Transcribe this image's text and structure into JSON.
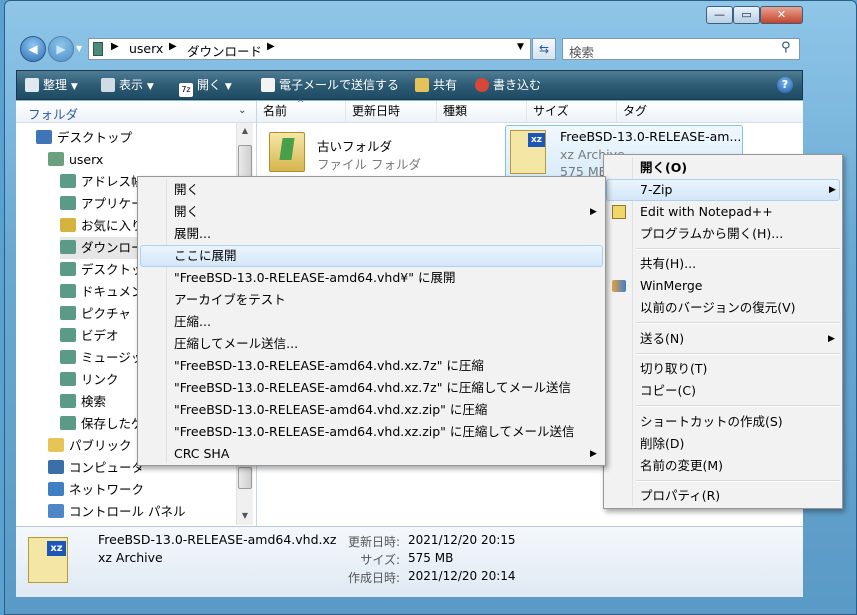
{
  "window": {
    "caption_buttons": [
      "minimize",
      "maximize",
      "close"
    ]
  },
  "nav": {
    "back_icon": "back-arrow-icon",
    "forward_icon": "forward-arrow-icon",
    "address": {
      "crumb_1": "userx",
      "crumb_2": "ダウンロード"
    },
    "search_placeholder": "検索"
  },
  "toolbar": {
    "organize": "整理",
    "view": "表示",
    "open": "開く",
    "email": "電子メールで送信する",
    "share": "共有",
    "burn": "書き込む",
    "help": "?"
  },
  "sidebar": {
    "header": "フォルダ",
    "items": [
      {
        "label": "デスクトップ",
        "icon": "desktop-icon"
      },
      {
        "label": "userx",
        "icon": "user-folder-icon"
      },
      {
        "label": "アドレス帳",
        "icon": "contacts-icon"
      },
      {
        "label": "アプリケー",
        "icon": "folder-icon"
      },
      {
        "label": "お気に入り",
        "icon": "favorites-icon"
      },
      {
        "label": "ダウンロー",
        "icon": "folder-icon"
      },
      {
        "label": "デスクトッ",
        "icon": "folder-icon"
      },
      {
        "label": "ドキュメン",
        "icon": "folder-icon"
      },
      {
        "label": "ピクチャ",
        "icon": "folder-icon"
      },
      {
        "label": "ビデオ",
        "icon": "folder-icon"
      },
      {
        "label": "ミュージッ",
        "icon": "folder-icon"
      },
      {
        "label": "リンク",
        "icon": "folder-icon"
      },
      {
        "label": "検索",
        "icon": "folder-icon"
      },
      {
        "label": "保存したゲ",
        "icon": "folder-icon"
      },
      {
        "label": "パブリック",
        "icon": "folder-icon"
      },
      {
        "label": "コンピュータ",
        "icon": "computer-icon"
      },
      {
        "label": "ネットワーク",
        "icon": "network-icon"
      },
      {
        "label": "コントロール パネル",
        "icon": "control-panel-icon"
      }
    ]
  },
  "columns": [
    "名前",
    "更新日時",
    "種類",
    "サイズ",
    "タグ"
  ],
  "files": [
    {
      "name": "古いフォルダ",
      "type": "ファイル フォルダ"
    },
    {
      "name": "FreeBSD-13.0-RELEASE-am...",
      "type": "xz Archive",
      "size": "575 MB"
    }
  ],
  "details": {
    "filename": "FreeBSD-13.0-RELEASE-amd64.vhd.xz",
    "type": "xz Archive",
    "modified_label": "更新日時:",
    "modified_value": "2021/12/20 20:15",
    "size_label": "サイズ:",
    "size_value": "575 MB",
    "created_label": "作成日時:",
    "created_value": "2021/12/20 20:14",
    "icon_badge": "xz"
  },
  "context_menu": {
    "items": [
      {
        "label": "開く(O)"
      },
      {
        "label": "7-Zip"
      },
      {
        "label": "Edit with Notepad++"
      },
      {
        "label": "プログラムから開く(H)..."
      },
      {
        "label": "共有(H)..."
      },
      {
        "label": "WinMerge"
      },
      {
        "label": "以前のバージョンの復元(V)"
      },
      {
        "label": "送る(N)"
      },
      {
        "label": "切り取り(T)"
      },
      {
        "label": "コピー(C)"
      },
      {
        "label": "ショートカットの作成(S)"
      },
      {
        "label": "削除(D)"
      },
      {
        "label": "名前の変更(M)"
      },
      {
        "label": "プロパティ(R)"
      }
    ]
  },
  "zip_submenu": {
    "items": [
      {
        "label": "開く"
      },
      {
        "label": "開く"
      },
      {
        "label": "展開..."
      },
      {
        "label": "ここに展開"
      },
      {
        "label": "\"FreeBSD-13.0-RELEASE-amd64.vhd¥\" に展開"
      },
      {
        "label": "アーカイブをテスト"
      },
      {
        "label": "圧縮..."
      },
      {
        "label": "圧縮してメール送信..."
      },
      {
        "label": "\"FreeBSD-13.0-RELEASE-amd64.vhd.xz.7z\" に圧縮"
      },
      {
        "label": "\"FreeBSD-13.0-RELEASE-amd64.vhd.xz.7z\" に圧縮してメール送信"
      },
      {
        "label": "\"FreeBSD-13.0-RELEASE-amd64.vhd.xz.zip\" に圧縮"
      },
      {
        "label": "\"FreeBSD-13.0-RELEASE-amd64.vhd.xz.zip\" に圧縮してメール送信"
      },
      {
        "label": "CRC SHA"
      }
    ]
  }
}
